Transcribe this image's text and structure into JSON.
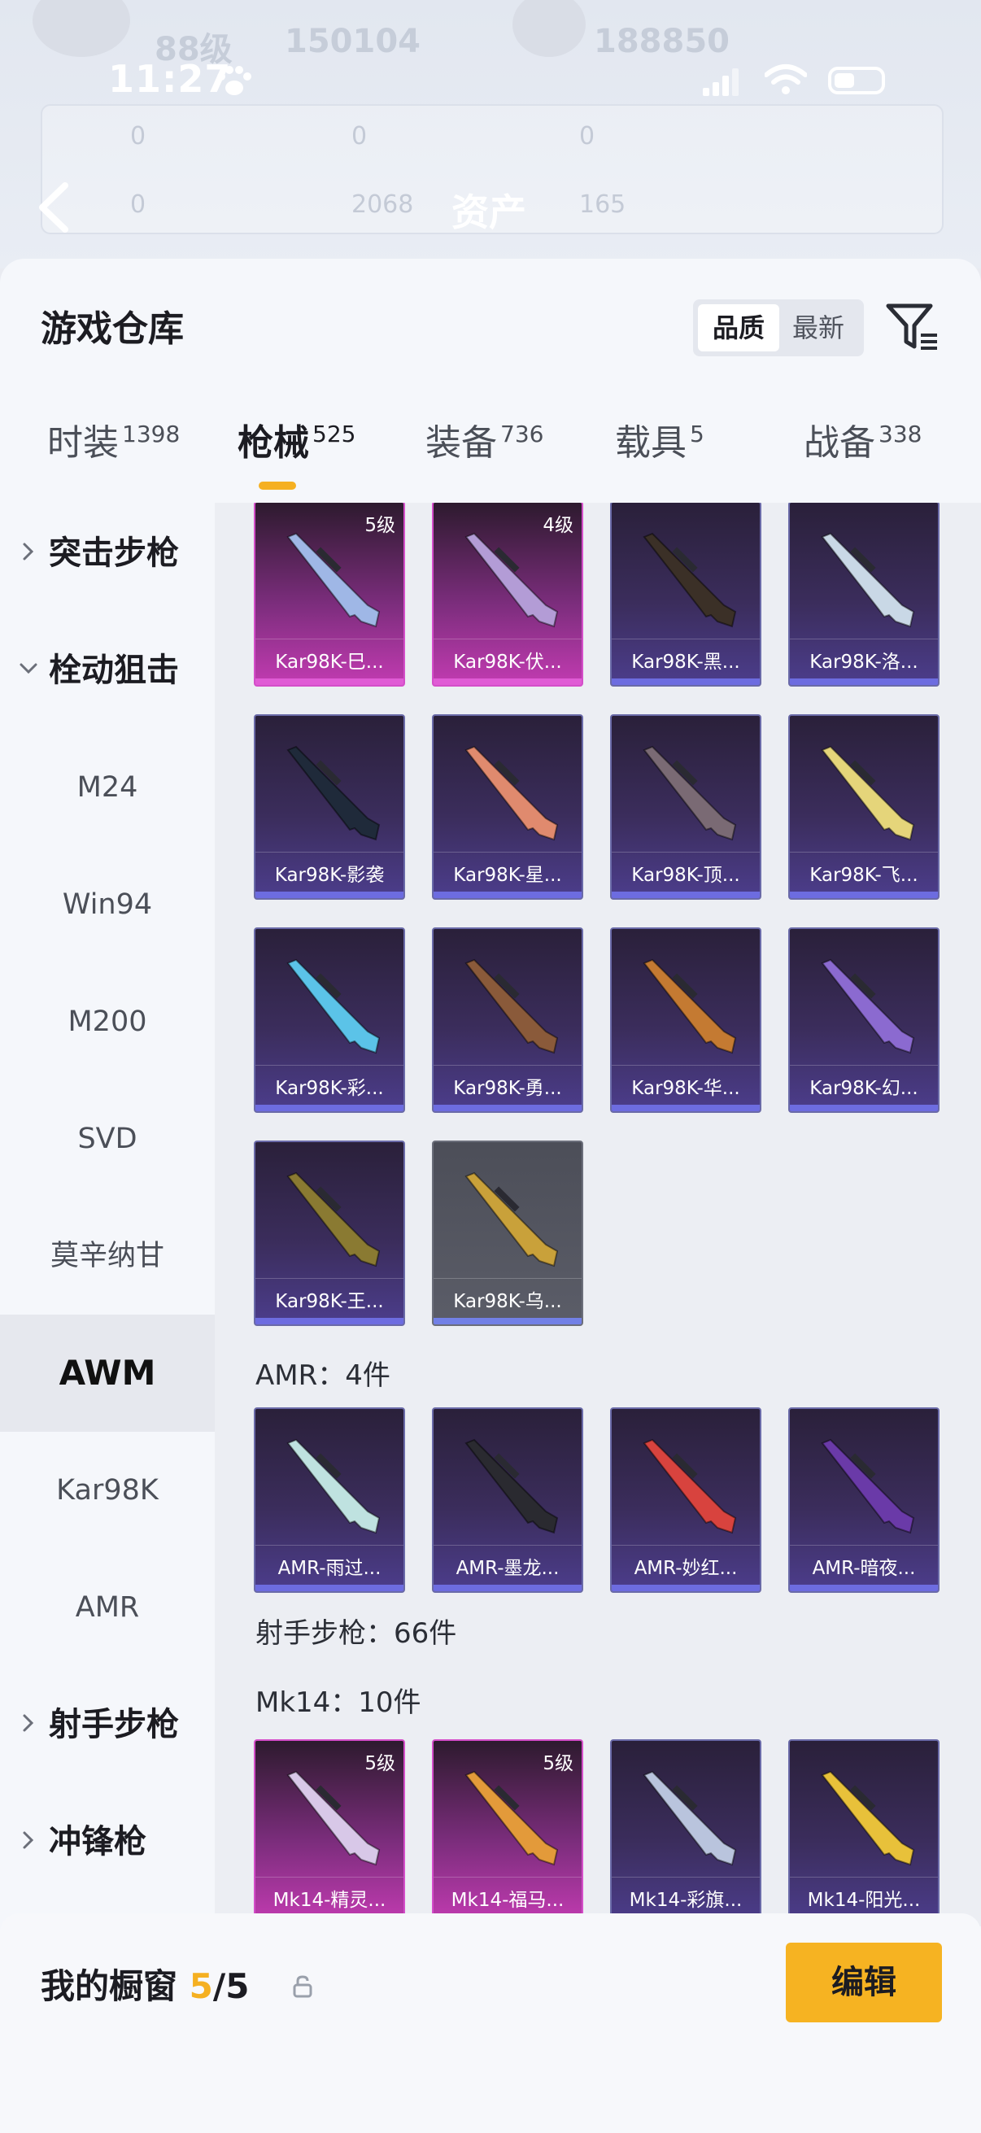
{
  "status_bar": {
    "time": "11:27"
  },
  "background": {
    "stats_top": [
      "88级",
      "150104",
      "188850"
    ],
    "row_values": [
      "0",
      "0",
      "0",
      "0",
      "2068",
      "165"
    ],
    "header_title": "资产"
  },
  "sheet": {
    "title": "游戏仓库",
    "sort_options": [
      "品质",
      "最新"
    ],
    "tabs": [
      {
        "label": "时装",
        "count": "1398"
      },
      {
        "label": "枪械",
        "count": "525"
      },
      {
        "label": "装备",
        "count": "736"
      },
      {
        "label": "载具",
        "count": "5"
      },
      {
        "label": "战备",
        "count": "338"
      }
    ]
  },
  "sidebar": {
    "items": [
      {
        "label": "突击步枪",
        "type": "group",
        "expanded": false
      },
      {
        "label": "栓动狙击",
        "type": "group",
        "expanded": true
      },
      {
        "label": "M24",
        "type": "sub"
      },
      {
        "label": "Win94",
        "type": "sub"
      },
      {
        "label": "M200",
        "type": "sub"
      },
      {
        "label": "SVD",
        "type": "sub"
      },
      {
        "label": "莫辛纳甘",
        "type": "sub"
      },
      {
        "label": "AWM",
        "type": "sub",
        "active": true
      },
      {
        "label": "Kar98K",
        "type": "sub"
      },
      {
        "label": "AMR",
        "type": "sub"
      },
      {
        "label": "射手步枪",
        "type": "group",
        "expanded": false
      },
      {
        "label": "冲锋枪",
        "type": "group",
        "expanded": false
      }
    ]
  },
  "content": {
    "kar98k_cards": [
      {
        "name": "Kar98K-巳...",
        "level": "5级",
        "rarity": "magenta",
        "color": "#9fb7e6"
      },
      {
        "name": "Kar98K-伏...",
        "level": "4级",
        "rarity": "magenta",
        "color": "#b39cd6"
      },
      {
        "name": "Kar98K-黑...",
        "level": "",
        "rarity": "purple",
        "color": "#3b3027"
      },
      {
        "name": "Kar98K-洛...",
        "level": "",
        "rarity": "purple",
        "color": "#c9d8e6"
      },
      {
        "name": "Kar98K-影袭",
        "level": "",
        "rarity": "purple",
        "color": "#1f2a3a"
      },
      {
        "name": "Kar98K-星...",
        "level": "",
        "rarity": "purple",
        "color": "#e08a6e"
      },
      {
        "name": "Kar98K-顶...",
        "level": "",
        "rarity": "purple",
        "color": "#7a6a74"
      },
      {
        "name": "Kar98K-飞...",
        "level": "",
        "rarity": "purple",
        "color": "#e5d57a"
      },
      {
        "name": "Kar98K-彩...",
        "level": "",
        "rarity": "purple",
        "color": "#5bc3e8"
      },
      {
        "name": "Kar98K-勇...",
        "level": "",
        "rarity": "purple",
        "color": "#8a5a3a"
      },
      {
        "name": "Kar98K-华...",
        "level": "",
        "rarity": "purple",
        "color": "#c47a32"
      },
      {
        "name": "Kar98K-幻...",
        "level": "",
        "rarity": "purple",
        "color": "#8b6ad0"
      },
      {
        "name": "Kar98K-王...",
        "level": "",
        "rarity": "purple",
        "color": "#8a7a32"
      },
      {
        "name": "Kar98K-乌...",
        "level": "",
        "rarity": "grey",
        "color": "#c9a13a"
      }
    ],
    "amr_label": "AMR：4件",
    "amr_cards": [
      {
        "name": "AMR-雨过...",
        "level": "",
        "rarity": "purple",
        "color": "#bfe2e0"
      },
      {
        "name": "AMR-墨龙...",
        "level": "",
        "rarity": "purple",
        "color": "#2a2a30"
      },
      {
        "name": "AMR-妙红...",
        "level": "",
        "rarity": "purple",
        "color": "#d8433e"
      },
      {
        "name": "AMR-暗夜...",
        "level": "",
        "rarity": "purple",
        "color": "#6a3aa8"
      }
    ],
    "marksman_label": "射手步枪：66件",
    "mk14_label": "Mk14：10件",
    "mk14_cards": [
      {
        "name": "Mk14-精灵...",
        "level": "5级",
        "rarity": "magenta",
        "color": "#d8c8e8"
      },
      {
        "name": "Mk14-福马...",
        "level": "5级",
        "rarity": "magenta",
        "color": "#e39a3a"
      },
      {
        "name": "Mk14-彩旗...",
        "level": "",
        "rarity": "purple",
        "color": "#b9c4dd"
      },
      {
        "name": "Mk14-阳光...",
        "level": "",
        "rarity": "purple",
        "color": "#e8c13a"
      }
    ]
  },
  "bottom": {
    "showcase_label": "我的橱窗",
    "showcase_count": "5",
    "showcase_total": "/5",
    "edit_label": "编辑"
  },
  "colors": {
    "accent": "#f6b322",
    "magenta_rarity": "#c23bb1",
    "purple_rarity": "#4c3d8c"
  },
  "icons": [
    "paw-icon",
    "signal-icon",
    "wifi-icon",
    "battery-icon",
    "back-arrow-icon",
    "filter-icon",
    "chevron-right-icon",
    "chevron-down-icon",
    "share-icon",
    "lock-icon"
  ]
}
